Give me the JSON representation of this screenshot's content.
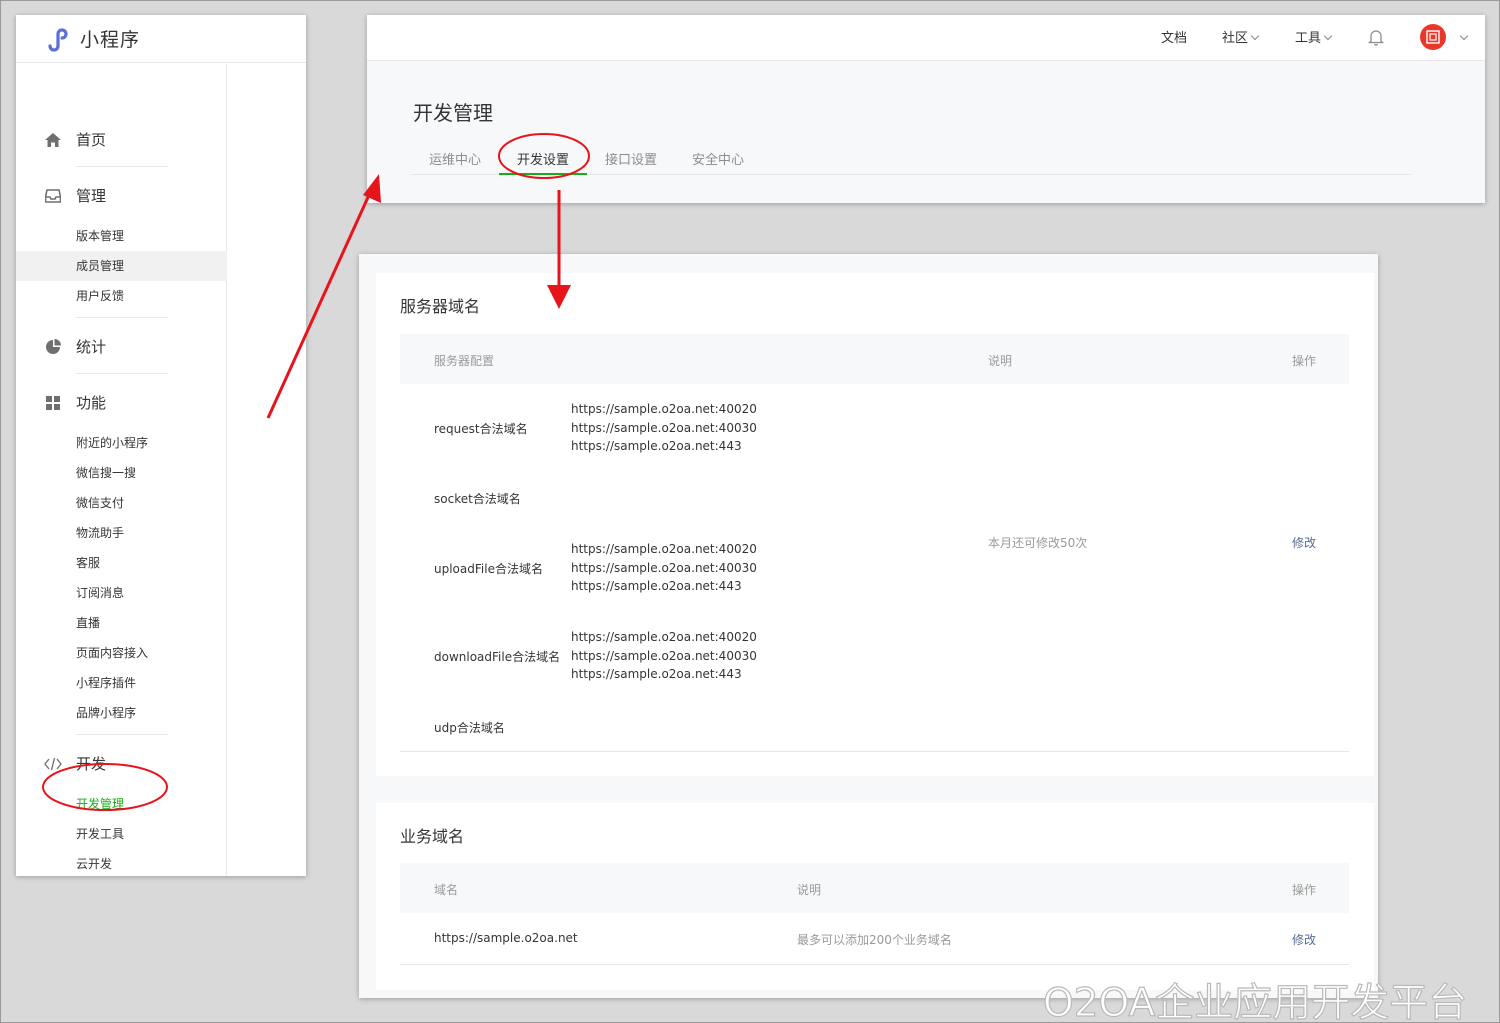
{
  "sidebar": {
    "app_title": "小程序",
    "sections": [
      {
        "label": "首页",
        "icon": "home-icon"
      },
      {
        "label": "管理",
        "icon": "inbox-icon"
      },
      {
        "label": "统计",
        "icon": "pie-chart-icon"
      },
      {
        "label": "功能",
        "icon": "grid-icon"
      },
      {
        "label": "开发",
        "icon": "code-icon"
      }
    ],
    "manage_items": [
      "版本管理",
      "成员管理",
      "用户反馈"
    ],
    "feature_items": [
      "附近的小程序",
      "微信搜一搜",
      "微信支付",
      "物流助手",
      "客服",
      "订阅消息",
      "直播",
      "页面内容接入",
      "小程序插件",
      "品牌小程序"
    ],
    "dev_items": [
      "开发管理",
      "开发工具",
      "云开发"
    ]
  },
  "topbar": {
    "docs": "文档",
    "community": "社区",
    "tools": "工具"
  },
  "page": {
    "title": "开发管理",
    "tabs": [
      "运维中心",
      "开发设置",
      "接口设置",
      "安全中心"
    ],
    "active_tab": "开发设置"
  },
  "server_domain": {
    "title": "服务器域名",
    "columns": [
      "服务器配置",
      "说明",
      "操作"
    ],
    "rows": [
      {
        "name": "request合法域名",
        "urls": [
          "https://sample.o2oa.net:40020",
          "https://sample.o2oa.net:40030",
          "https://sample.o2oa.net:443"
        ]
      },
      {
        "name": "socket合法域名",
        "urls": []
      },
      {
        "name": "uploadFile合法域名",
        "urls": [
          "https://sample.o2oa.net:40020",
          "https://sample.o2oa.net:40030",
          "https://sample.o2oa.net:443"
        ]
      },
      {
        "name": "downloadFile合法域名",
        "urls": [
          "https://sample.o2oa.net:40020",
          "https://sample.o2oa.net:40030",
          "https://sample.o2oa.net:443"
        ]
      },
      {
        "name": "udp合法域名",
        "urls": []
      }
    ],
    "note": "本月还可修改50次",
    "action": "修改"
  },
  "business_domain": {
    "title": "业务域名",
    "columns": [
      "域名",
      "说明",
      "操作"
    ],
    "domain": "https://sample.o2oa.net",
    "note": "最多可以添加200个业务域名",
    "action": "修改"
  },
  "watermark": "O2OA企业应用开发平台",
  "colors": {
    "accent_green": "#1aad19",
    "link_blue": "#576b95",
    "annotation_red": "#e8141c",
    "avatar_red": "#e8382c"
  }
}
